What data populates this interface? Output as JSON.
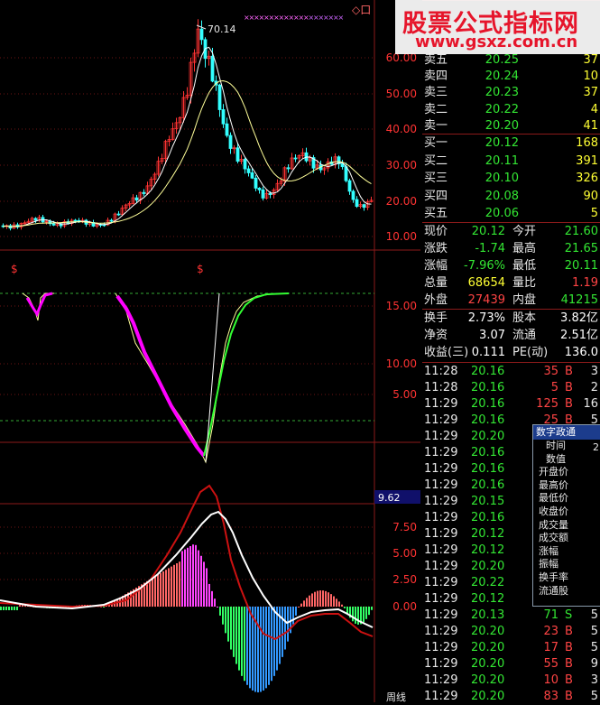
{
  "upper_chart": {
    "y_ticks": [
      "60.00",
      "50.00",
      "40.00",
      "30.00",
      "20.00",
      "10.00"
    ],
    "peak_label": "70.14",
    "markers": [
      "$",
      "$"
    ],
    "corner_icons": "◇口",
    "colors": {
      "up": "#ff3333",
      "down": "#33ffff",
      "ma_short": "#ffffff",
      "ma_long": "#ffff99",
      "grid": "#8b1a1a",
      "axis_text": "#ff3333"
    }
  },
  "middle_chart": {
    "y_ticks": [
      "15.00",
      "10.00",
      "5.00"
    ],
    "colors": {
      "thick_line": "#ff00ff",
      "thin_line": "#ffff99",
      "green_line": "#33ff33",
      "dashed": "#33aa33"
    }
  },
  "macd_chart": {
    "value_badge": "9.62",
    "y_ticks": [
      "7.50",
      "5.00",
      "2.50",
      "0.00"
    ],
    "colors": {
      "pos_hist": "#ff6666",
      "neg_hist": "#33ff66",
      "neg_hist2": "#3399ff",
      "dif": "#ffffff",
      "dea": "#cc1111"
    }
  },
  "bottom_label": "周线",
  "watermark": {
    "title": "股票公式指标网",
    "url": "www.gsxz.com.cn"
  },
  "order_book": {
    "asks": [
      {
        "label": "卖五",
        "price": "20.25",
        "vol": "37"
      },
      {
        "label": "卖四",
        "price": "20.24",
        "vol": "10"
      },
      {
        "label": "卖三",
        "price": "20.23",
        "vol": "37"
      },
      {
        "label": "卖二",
        "price": "20.22",
        "vol": "4"
      },
      {
        "label": "卖一",
        "price": "20.20",
        "vol": "41"
      }
    ],
    "bids": [
      {
        "label": "买一",
        "price": "20.12",
        "vol": "168"
      },
      {
        "label": "买二",
        "price": "20.11",
        "vol": "391"
      },
      {
        "label": "买三",
        "price": "20.10",
        "vol": "326"
      },
      {
        "label": "买四",
        "price": "20.08",
        "vol": "90"
      },
      {
        "label": "买五",
        "price": "20.06",
        "vol": "5"
      }
    ]
  },
  "stats": [
    {
      "l1": "现价",
      "v1": "20.12",
      "c1": "g",
      "l2": "今开",
      "v2": "21.60",
      "c2": "g"
    },
    {
      "l1": "涨跌",
      "v1": "-1.74",
      "c1": "g",
      "l2": "最高",
      "v2": "21.65",
      "c2": "g"
    },
    {
      "l1": "涨幅",
      "v1": "-7.96%",
      "c1": "g",
      "l2": "最低",
      "v2": "20.11",
      "c2": "g"
    },
    {
      "l1": "总量",
      "v1": "68654",
      "c1": "y",
      "l2": "量比",
      "v2": "1.19",
      "c2": "r"
    },
    {
      "l1": "外盘",
      "v1": "27439",
      "c1": "r",
      "l2": "内盘",
      "v2": "41215",
      "c2": "g"
    }
  ],
  "fundamentals": [
    {
      "l1": "换手",
      "v1": "2.73%",
      "l2": "股本",
      "v2": "3.82亿"
    },
    {
      "l1": "净资",
      "v1": "3.07",
      "l2": "流通",
      "v2": "2.51亿"
    },
    {
      "l1": "收益(三)",
      "v1": "0.111",
      "l2": "PE(动)",
      "v2": "136.0"
    }
  ],
  "ticks": [
    {
      "time": "11:28",
      "price": "20.16",
      "vol": "35",
      "bs": "B",
      "n": "3"
    },
    {
      "time": "11:28",
      "price": "20.16",
      "vol": "5",
      "bs": "B",
      "n": "2"
    },
    {
      "time": "11:29",
      "price": "20.16",
      "vol": "125",
      "bs": "B",
      "n": "16"
    },
    {
      "time": "11:29",
      "price": "20.16",
      "vol": "25",
      "bs": "B",
      "n": "5"
    },
    {
      "time": "11:29",
      "price": "20.20",
      "vol": "",
      "bs": "",
      "n": ""
    },
    {
      "time": "11:29",
      "price": "20.16",
      "vol": "",
      "bs": "",
      "n": ""
    },
    {
      "time": "11:29",
      "price": "20.16",
      "vol": "",
      "bs": "",
      "n": ""
    },
    {
      "time": "11:29",
      "price": "20.16",
      "vol": "",
      "bs": "",
      "n": ""
    },
    {
      "time": "11:29",
      "price": "20.15",
      "vol": "",
      "bs": "",
      "n": ""
    },
    {
      "time": "11:29",
      "price": "20.16",
      "vol": "",
      "bs": "",
      "n": ""
    },
    {
      "time": "11:29",
      "price": "20.12",
      "vol": "",
      "bs": "",
      "n": ""
    },
    {
      "time": "11:29",
      "price": "20.12",
      "vol": "",
      "bs": "",
      "n": ""
    },
    {
      "time": "11:29",
      "price": "20.20",
      "vol": "",
      "bs": "",
      "n": ""
    },
    {
      "time": "11:29",
      "price": "20.22",
      "vol": "",
      "bs": "",
      "n": ""
    },
    {
      "time": "11:29",
      "price": "20.12",
      "vol": "",
      "bs": "",
      "n": ""
    },
    {
      "time": "11:29",
      "price": "20.13",
      "vol": "71",
      "bs": "S",
      "n": "5"
    },
    {
      "time": "11:29",
      "price": "20.20",
      "vol": "23",
      "bs": "B",
      "n": "5"
    },
    {
      "time": "11:29",
      "price": "20.20",
      "vol": "17",
      "bs": "B",
      "n": "5"
    },
    {
      "time": "11:29",
      "price": "20.20",
      "vol": "55",
      "bs": "B",
      "n": "9"
    },
    {
      "time": "11:29",
      "price": "20.20",
      "vol": "10",
      "bs": "B",
      "n": "3"
    },
    {
      "time": "11:29",
      "price": "20.20",
      "vol": "83",
      "bs": "B",
      "n": "5"
    }
  ],
  "popup": {
    "title": "数字政通",
    "items": [
      "时间",
      "数值",
      "开盘价",
      "最高价",
      "最低价",
      "收盘价",
      "成交量",
      "成交额",
      "涨幅",
      "振幅",
      "换手率",
      "流通股"
    ],
    "time_value": "2"
  }
}
